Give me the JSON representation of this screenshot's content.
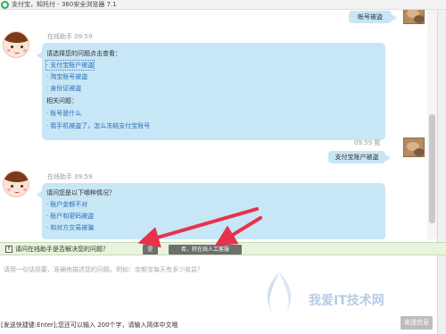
{
  "window": {
    "title": "支付宝，知托付 - 360安全浏览器 7.1"
  },
  "chat": {
    "top_user_bubble": "帐号被盗",
    "assistant_msg_1": {
      "sender": "在线助手",
      "time": "09:59",
      "intro": "请选择您的问题点击查看：",
      "options": [
        "支付宝账户被盗",
        "淘宝账号被盗",
        "身份证被盗"
      ],
      "related_title": "相关问题：",
      "related": [
        "账号是什么",
        "我手机被盗了，怎么冻结支付宝账号"
      ]
    },
    "user_msg": {
      "time": "09:59",
      "sender": "我",
      "text": "支付宝账户被盗"
    },
    "assistant_msg_2": {
      "sender": "在线助手",
      "time": "09:59",
      "intro": "请问您是以下哪种情况？",
      "options": [
        "账户金额不对",
        "账户和密码被盗",
        "和对方交易被骗"
      ]
    }
  },
  "feedback": {
    "question": "请问在线助手是否解决您的问题？",
    "yes_label": "是",
    "no_label": "否，转在线人工客服"
  },
  "composer": {
    "placeholder": "请用一句话简要、准确地描述您的问题，例如：余额宝每天有多少收益？",
    "hint": "[发送快捷键:Enter];您还可以输入 200个字，请输入简体中文哦",
    "send_label": "发送信息"
  },
  "watermark": {
    "text": "我爱IT技术网"
  },
  "colors": {
    "bubble": "#c7e6f6",
    "link": "#2a6fb8",
    "feedback_bar": "#e8f4dd",
    "arrow": "#e8324a"
  }
}
